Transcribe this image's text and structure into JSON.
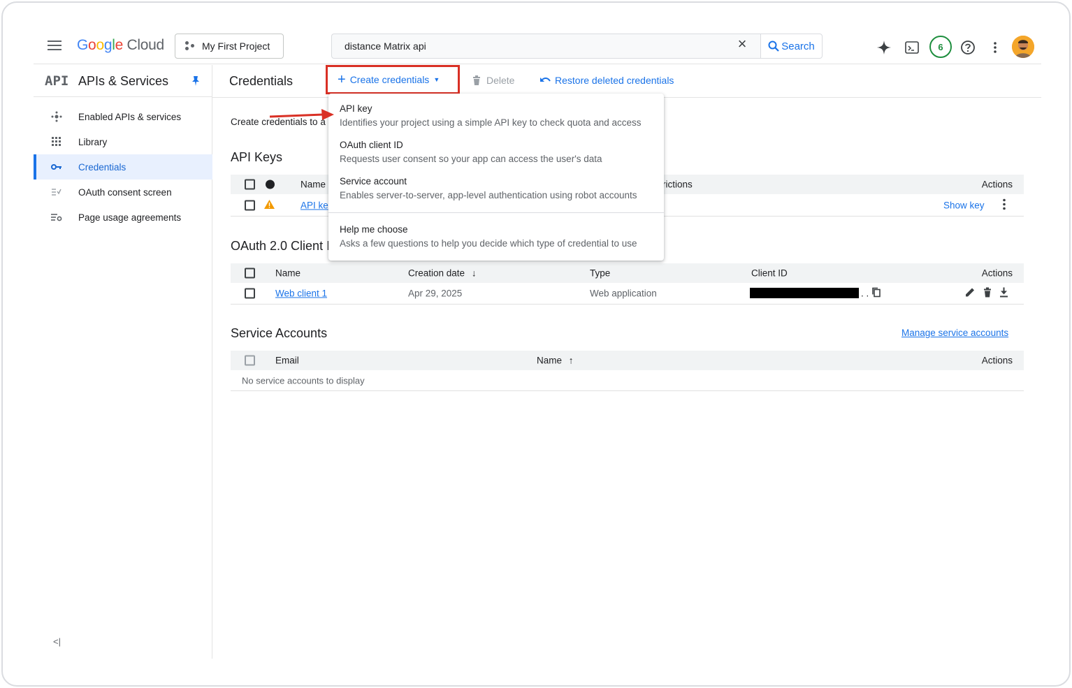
{
  "topbar": {
    "logo_google": [
      "G",
      "o",
      "o",
      "g",
      "l",
      "e"
    ],
    "logo_cloud": "Cloud",
    "project": "My First Project",
    "search_value": "distance Matrix api",
    "search_button": "Search",
    "notifications_count": "6"
  },
  "sidebar": {
    "badge": "API",
    "title": "APIs & Services",
    "items": [
      {
        "label": "Enabled APIs & services",
        "icon": "hub-icon"
      },
      {
        "label": "Library",
        "icon": "library-icon"
      },
      {
        "label": "Credentials",
        "icon": "key-icon",
        "active": true
      },
      {
        "label": "OAuth consent screen",
        "icon": "consent-icon"
      },
      {
        "label": "Page usage agreements",
        "icon": "settings-list-icon"
      }
    ],
    "collapse": "<|"
  },
  "header": {
    "title": "Credentials",
    "create_label": "Create credentials",
    "delete_label": "Delete",
    "restore_label": "Restore deleted credentials"
  },
  "intro_text": "Create credentials to a",
  "api_keys": {
    "title": "API Keys",
    "col_name": "Name",
    "col_restrictions": "rictions",
    "col_actions": "Actions",
    "row_name": "API ke",
    "row_action": "Show key"
  },
  "oauth": {
    "title": "OAuth 2.0 Client I",
    "col_name": "Name",
    "col_date": "Creation date",
    "col_type": "Type",
    "col_client_id": "Client ID",
    "col_actions": "Actions",
    "row_name": "Web client 1",
    "row_date": "Apr 29, 2025",
    "row_type": "Web application",
    "row_client_id_suffix": ". ."
  },
  "service_accounts": {
    "title": "Service Accounts",
    "manage_link": "Manage service accounts",
    "col_email": "Email",
    "col_name": "Name",
    "col_actions": "Actions",
    "empty": "No service accounts to display"
  },
  "dropdown": {
    "items": [
      {
        "title": "API key",
        "desc": "Identifies your project using a simple API key to check quota and access"
      },
      {
        "title": "OAuth client ID",
        "desc": "Requests user consent so your app can access the user's data"
      },
      {
        "title": "Service account",
        "desc": "Enables server-to-server, app-level authentication using robot accounts"
      },
      {
        "title": "Help me choose",
        "desc": "Asks a few questions to help you decide which type of credential to use"
      }
    ]
  },
  "colors": {
    "accent": "#1a73e8",
    "highlight_border": "#d93025",
    "warning": "#f29900",
    "badge_green": "#1e8e3e"
  }
}
